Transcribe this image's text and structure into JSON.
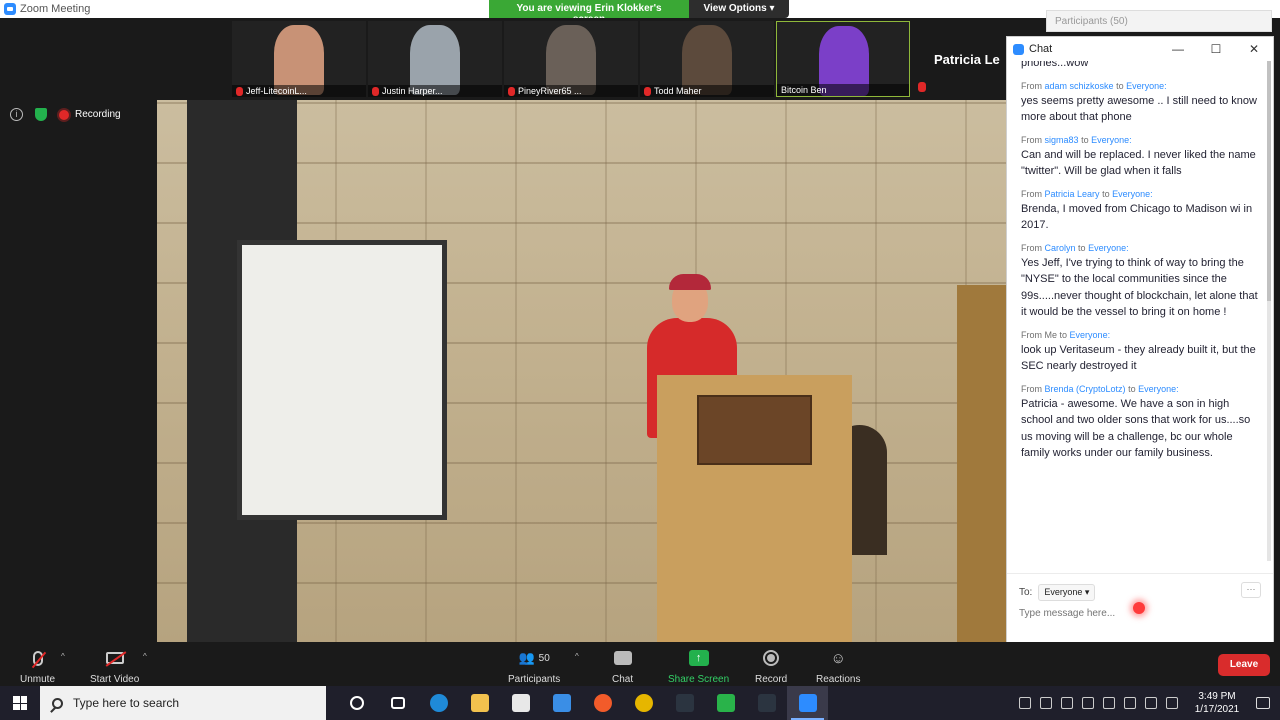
{
  "window": {
    "title": "Zoom Meeting"
  },
  "banner": {
    "viewing": "You are viewing Erin Klokker's screen",
    "view_options": "View Options ▾"
  },
  "thumbnails": [
    {
      "name": "Jeff-LitecoinL...",
      "color": "#c89276"
    },
    {
      "name": "Justin Harper...",
      "color": "#9aa3ab"
    },
    {
      "name": "PineyRiver65 ...",
      "color": "#6a6058"
    },
    {
      "name": "Todd Maher",
      "color": "#5c4a3c"
    },
    {
      "name": "Bitcoin Ben",
      "color": "#7b3fc8"
    }
  ],
  "active_speaker": "Patricia Le",
  "status": {
    "info_icon": "i",
    "recording": "Recording"
  },
  "participants_window": {
    "title": "Participants (50)"
  },
  "chat": {
    "title": "Chat",
    "top_fragment": "phones...wow",
    "messages": [
      {
        "from": "From",
        "sender": "adam schizkoske",
        "to": "to",
        "target": "Everyone:",
        "text": "yes seems pretty awesome .. I still need to know more about that phone"
      },
      {
        "from": "From",
        "sender": "sigma83",
        "to": "to",
        "target": "Everyone:",
        "text": "Can and will be replaced.  I never liked the name \"twitter\". Will be glad when it falls"
      },
      {
        "from": "From",
        "sender": "Patricia Leary",
        "to": " to",
        "target": "Everyone:",
        "text": "Brenda, I moved from Chicago to Madison wi in 2017."
      },
      {
        "from": "From",
        "sender": "Carolyn",
        "to": "to",
        "target": "Everyone:",
        "text": "Yes Jeff, I've trying to think of way to bring the \"NYSE\" to the local communities since the 99s.....never thought of blockchain, let alone that it would be the vessel to bring it on home !"
      },
      {
        "from": "From Me",
        "sender": "",
        "to": "to",
        "target": "Everyone:",
        "text": "look up Veritaseum - they already built it, but the SEC nearly destroyed it"
      },
      {
        "from": "From",
        "sender": "Brenda (CryptoLotz)",
        "to": "to",
        "target": "Everyone:",
        "text": "Patricia - awesome.  We have a son in high school and two older sons that work for us....so us moving will be a challenge, bc our whole family works under our family business."
      }
    ],
    "to_label": "To:",
    "recipient": "Everyone ▾",
    "more": "···",
    "placeholder": "Type message here..."
  },
  "controls": {
    "unmute": "Unmute",
    "start_video": "Start Video",
    "participants_count": "50",
    "participants": "Participants",
    "chat": "Chat",
    "share_screen": "Share Screen",
    "record": "Record",
    "reactions": "Reactions",
    "leave": "Leave",
    "caret": "^"
  },
  "taskbar": {
    "search_placeholder": "Type here to search",
    "apps": [
      {
        "name": "cortana-icon",
        "color": "transparent"
      },
      {
        "name": "task-view-icon",
        "color": "transparent"
      },
      {
        "name": "edge-icon",
        "color": "#1f8ad8"
      },
      {
        "name": "file-explorer-icon",
        "color": "#f2c14e"
      },
      {
        "name": "store-icon",
        "color": "#e8e8e8"
      },
      {
        "name": "mail-icon",
        "color": "#3a8ee6"
      },
      {
        "name": "brave-icon",
        "color": "#f25b2a"
      },
      {
        "name": "chrome-icon",
        "color": "#e6b600"
      },
      {
        "name": "app-icon",
        "color": "#2b3440"
      },
      {
        "name": "upload-icon",
        "color": "#29b34a"
      },
      {
        "name": "app2-icon",
        "color": "#2b3440"
      },
      {
        "name": "zoom-icon",
        "color": "#2d8cff"
      }
    ],
    "time": "3:49 PM",
    "date": "1/17/2021"
  }
}
